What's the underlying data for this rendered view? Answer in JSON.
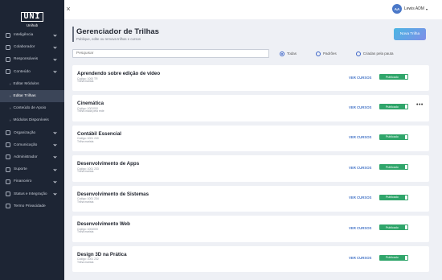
{
  "logo": {
    "mark": "UNI",
    "sub": "Unihub"
  },
  "sidebar": {
    "items": [
      {
        "label": "Inteligência",
        "type": "main",
        "chevron": true,
        "icon": "brain-icon"
      },
      {
        "label": "Colaborador",
        "type": "main",
        "chevron": true,
        "icon": "user-icon"
      },
      {
        "label": "Responsáveis",
        "type": "main",
        "chevron": true,
        "icon": "users-icon"
      },
      {
        "label": "Conteúdo",
        "type": "main",
        "chevron": true,
        "icon": "book-icon"
      },
      {
        "label": "Editar Módulos",
        "type": "sub",
        "chevron": false,
        "active": false
      },
      {
        "label": "Editar Trilhas",
        "type": "sub",
        "chevron": false,
        "active": true
      },
      {
        "label": "Conteúdo de Apoio",
        "type": "sub",
        "chevron": false,
        "active": false
      },
      {
        "label": "Módulos Disponíveis",
        "type": "sub",
        "chevron": false,
        "active": false
      },
      {
        "label": "Organização",
        "type": "main",
        "chevron": true,
        "icon": "org-icon"
      },
      {
        "label": "Comunicação",
        "type": "main",
        "chevron": true,
        "icon": "chat-icon"
      },
      {
        "label": "Administrador",
        "type": "main",
        "chevron": true,
        "icon": "admin-icon"
      },
      {
        "label": "Suporte",
        "type": "main",
        "chevron": true,
        "icon": "support-icon"
      },
      {
        "label": "Financeiro",
        "type": "main",
        "chevron": true,
        "icon": "finance-icon"
      },
      {
        "label": "Status e Integração",
        "type": "main",
        "chevron": true,
        "icon": "integration-icon"
      },
      {
        "label": "Termo Privacidade",
        "type": "main",
        "chevron": false,
        "icon": "document-icon"
      }
    ]
  },
  "topbar": {
    "close": "×",
    "avatar": "AA",
    "user_name": "Lewis ADM",
    "user_caret": "▾"
  },
  "header": {
    "title": "Gerenciador de Trilhas",
    "subtitle": "Publique, edite ou remova trilhas e cursos",
    "new_button": "Nova Trilha"
  },
  "filter": {
    "search_placeholder": "Pesquisar",
    "options": [
      {
        "label": "Todas",
        "selected": true
      },
      {
        "label": "Padrões",
        "selected": false
      },
      {
        "label": "Criadas pela pauta",
        "selected": false
      }
    ]
  },
  "trilhas": [
    {
      "title": "Aprendendo sobre edição de vídeo",
      "code": "Código: 1000 TR",
      "type": "Trilha marista",
      "view": "VER CURSOS",
      "status": "Publicado",
      "more": false
    },
    {
      "title": "Cinemática",
      "code": "Código: 1001000",
      "type": "Trilha criada pela rede",
      "view": "VER CURSOS",
      "status": "Publicado",
      "more": true
    },
    {
      "title": "Contábil Essencial",
      "code": "Código: 1001 240",
      "type": "Trilha marista",
      "view": "VER CURSOS",
      "status": "Publicado",
      "more": false
    },
    {
      "title": "Desenvolvimento de Apps",
      "code": "Código: 1001 233",
      "type": "Trilha marista",
      "view": "VER CURSOS",
      "status": "Publicado",
      "more": false
    },
    {
      "title": "Desenvolvimento de Sistemas",
      "code": "Código: 1001 234",
      "type": "Trilha marista",
      "view": "VER CURSOS",
      "status": "Publicado",
      "more": false
    },
    {
      "title": "Desenvolvimento Web",
      "code": "Código: 1004000",
      "type": "Trilha marista",
      "view": "VER CURSOS",
      "status": "Publicado",
      "more": false
    },
    {
      "title": "Design 3D na Prática",
      "code": "Código: 1001 232",
      "type": "Trilha marista",
      "view": "VER CURSOS",
      "status": "Publicado",
      "more": false
    }
  ],
  "colors": {
    "sidebar": "#1d2534",
    "accent": "#4a78c8",
    "published": "#2fa56a"
  }
}
